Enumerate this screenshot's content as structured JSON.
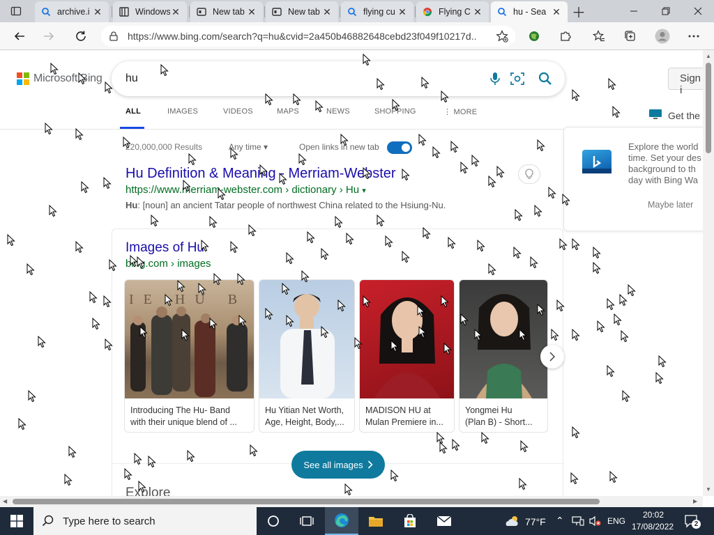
{
  "browser": {
    "tabs": [
      {
        "label": "archive.i",
        "favicon": "search-icon",
        "active": false
      },
      {
        "label": "Windows",
        "favicon": "page-icon",
        "active": false
      },
      {
        "label": "New tab",
        "favicon": "newtab-icon",
        "active": false
      },
      {
        "label": "New tab",
        "favicon": "newtab-icon",
        "active": false
      },
      {
        "label": "flying cu",
        "favicon": "search-icon",
        "active": false
      },
      {
        "label": "Flying C",
        "favicon": "chrome-icon",
        "active": false
      },
      {
        "label": "hu - Sea",
        "favicon": "search-icon",
        "active": true
      }
    ],
    "address": "https://www.bing.com/search?q=hu&cvid=2a450b46882648cebd23f049f10217d..."
  },
  "bing": {
    "logo_text": "Microsoft Bing",
    "query": "hu",
    "signin_label": "Sign i",
    "scopes": [
      "ALL",
      "IMAGES",
      "VIDEOS",
      "MAPS",
      "NEWS",
      "SHOPPING",
      "MORE"
    ],
    "get_the": "Get the",
    "results_count": "220,000,000 Results",
    "any_time": "Any time",
    "open_links": "Open links in new tab",
    "result": {
      "title": "Hu Definition & Meaning - Merriam-Webster",
      "url": "https://www.merriam-webster.com › dictionary › Hu",
      "snippet_term": "Hu",
      "snippet": ": [noun] an ancient Tatar people of northwest China related to the Hsiung-Nu."
    },
    "images": {
      "title": "Images of Hu",
      "url": "bing.com › images",
      "items": [
        {
          "cap1": "Introducing The Hu- Band",
          "cap2": "with their unique blend of ..."
        },
        {
          "cap1": "Hu Yitian Net Worth,",
          "cap2": "Age, Height, Body,..."
        },
        {
          "cap1": "MADISON HU at",
          "cap2": "Mulan Premiere in..."
        },
        {
          "cap1": "Yongmei Hu",
          "cap2": "(Plan B) - Short..."
        }
      ],
      "see_all": "See all images"
    },
    "explore": "Explore",
    "promo": {
      "lines": [
        "Explore the world",
        "time. Set your des",
        "background to th",
        "day with Bing Wa"
      ],
      "maybe_later": "Maybe later"
    }
  },
  "taskbar": {
    "search_placeholder": "Type here to search",
    "weather": "77°F",
    "language": "ENG",
    "time": "20:02",
    "date": "17/08/2022",
    "notifications": "2"
  },
  "colors": {
    "link": "#1a0dab",
    "url_green": "#006d21",
    "accent": "#174ae4",
    "button": "#0f7a9e",
    "taskbar": "#1f2b3a"
  }
}
